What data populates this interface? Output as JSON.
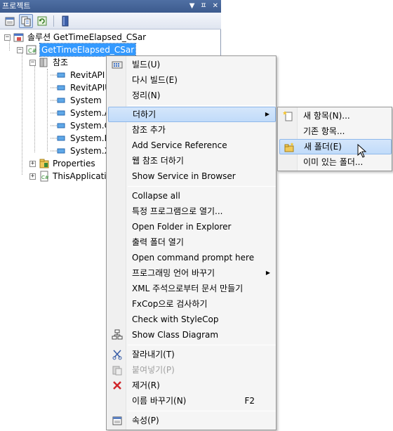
{
  "panel": {
    "title": "프로젝트",
    "controls": {
      "dropdown": "▼",
      "pin": "ㅍ",
      "close": "✕"
    }
  },
  "toolbar": {
    "buttons": [
      {
        "icon": "properties-icon"
      },
      {
        "icon": "show-all-files-icon"
      },
      {
        "icon": "refresh-icon"
      },
      {
        "icon": "view-code-icon"
      }
    ]
  },
  "tree": {
    "solution": "솔루션 GetTimeElapsed_CSar",
    "project": "GetTimeElapsed_CSar",
    "references_folder": "참조",
    "references": [
      "RevitAPI",
      "RevitAPIU",
      "System",
      "System.Ac",
      "System.Co",
      "System.Da",
      "System.Xr"
    ],
    "properties": "Properties",
    "this_application": "ThisApplicatio"
  },
  "context_menu": {
    "items": [
      {
        "label": "빌드(U)",
        "icon": "build-icon"
      },
      {
        "label": "다시 빌드(E)"
      },
      {
        "label": "정리(N)"
      },
      {
        "label": "더하기",
        "submenu": true,
        "highlighted": true
      },
      {
        "label": "참조 추가"
      },
      {
        "label": "Add Service Reference"
      },
      {
        "label": "웹 참조 더하기"
      },
      {
        "label": "Show Service in Browser"
      },
      {
        "label": "Collapse all"
      },
      {
        "label": "특정 프로그램으로 열기..."
      },
      {
        "label": "Open Folder in Explorer"
      },
      {
        "label": "출력 폴더 열기"
      },
      {
        "label": "Open command prompt here"
      },
      {
        "label": "프로그래밍 언어 바꾸기",
        "submenu": true
      },
      {
        "label": "XML 주석으로부터 문서 만들기"
      },
      {
        "label": "FxCop으로 검사하기"
      },
      {
        "label": "Check with StyleCop"
      },
      {
        "label": "Show Class Diagram",
        "icon": "class-diagram-icon"
      },
      {
        "label": "잘라내기(T)",
        "icon": "cut-icon"
      },
      {
        "label": "붙여넣기(P)",
        "icon": "paste-icon",
        "disabled": true
      },
      {
        "label": "제거(R)",
        "icon": "delete-icon"
      },
      {
        "label": "이름 바꾸기(N)",
        "shortcut": "F2"
      },
      {
        "label": "속성(P)",
        "icon": "properties-icon"
      }
    ]
  },
  "submenu": {
    "items": [
      {
        "label": "새 항목(N)...",
        "icon": "new-item-icon"
      },
      {
        "label": "기존 항목..."
      },
      {
        "label": "새 폴더(E)",
        "icon": "new-folder-icon",
        "highlighted": true
      },
      {
        "label": "이미 있는 폴더..."
      }
    ]
  },
  "colors": {
    "selection": "#3399ff",
    "highlight": "#c1dbf9",
    "titlebar": "#4a6aa0"
  }
}
